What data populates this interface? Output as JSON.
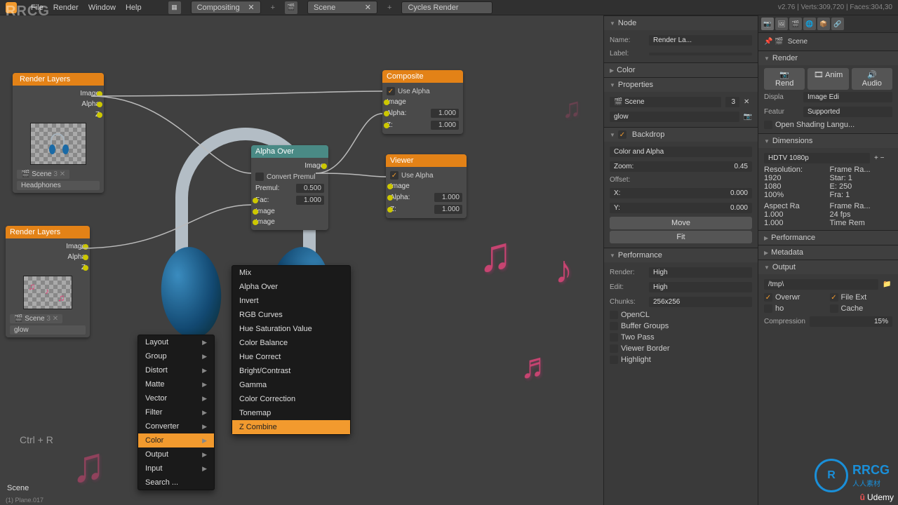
{
  "topbar": {
    "menus": [
      "File",
      "Render",
      "Window",
      "Help"
    ],
    "layout_label": "Compositing",
    "scene_label": "Scene",
    "engine_label": "Cycles Render",
    "stats": "v2.76 | Verts:309,720 | Faces:304,30"
  },
  "nodes": {
    "rl1": {
      "title": "Render Layers",
      "outs": [
        "Image",
        "Alpha",
        "Z"
      ],
      "scene_field": "Scene",
      "layer_field": "Headphones"
    },
    "rl2": {
      "title": "Render Layers",
      "outs": [
        "Image",
        "Alpha",
        "Z"
      ],
      "scene_field": "Scene",
      "layer_field": "glow"
    },
    "alpha_over": {
      "title": "Alpha Over",
      "out": "Image",
      "convert": "Convert Premul",
      "premul_v": "0.500",
      "fac": "Fac:",
      "fac_v": "1.000",
      "img": "Image",
      "img2": "Image"
    },
    "composite": {
      "title": "Composite",
      "use_alpha": "Use Alpha",
      "img": "Image",
      "alpha": "Alpha:",
      "alpha_v": "1.000",
      "z": "Z:",
      "z_v": "1.000"
    },
    "viewer": {
      "title": "Viewer",
      "use_alpha": "Use Alpha",
      "img": "Image",
      "alpha": "Alpha:",
      "alpha_v": "1.000",
      "z": "Z:",
      "z_v": "1.000"
    }
  },
  "ctx_menu_1": [
    "Layout",
    "Group",
    "Distort",
    "Matte",
    "Vector",
    "Filter",
    "Converter",
    "Color",
    "Output",
    "Input",
    "Search ..."
  ],
  "ctx_menu_2": [
    "Mix",
    "Alpha Over",
    "Invert",
    "RGB Curves",
    "Hue Saturation Value",
    "Color Balance",
    "Hue Correct",
    "Bright/Contrast",
    "Gamma",
    "Color Correction",
    "Tonemap",
    "Z Combine"
  ],
  "panel1": {
    "node_h": "Node",
    "name_l": "Name:",
    "name_v": "Render La...",
    "label_l": "Label:",
    "color_h": "Color",
    "props_h": "Properties",
    "scene_v": "Scene",
    "scene_count": "3",
    "layer_v": "glow",
    "backdrop_h": "Backdrop",
    "color_alpha": "Color and Alpha",
    "zoom_l": "Zoom:",
    "zoom_v": "0.45",
    "offset_l": "Offset:",
    "x_l": "X:",
    "x_v": "0.000",
    "y_l": "Y:",
    "y_v": "0.000",
    "move_btn": "Move",
    "fit_btn": "Fit",
    "perf_h": "Performance",
    "render_l": "Render:",
    "render_v": "High",
    "edit_l": "Edit:",
    "edit_v": "High",
    "chunks_l": "Chunks:",
    "chunks_v": "256x256",
    "opencl": "OpenCL",
    "buffer": "Buffer Groups",
    "twopass": "Two Pass",
    "viewer_b": "Viewer Border",
    "highlight": "Highlight"
  },
  "panel2": {
    "scene_h": "Scene",
    "render_h": "Render",
    "rend_btn": "Rend",
    "anim_btn": "Anim",
    "audio_btn": "Audio",
    "displa_l": "Displa",
    "displa_v": "Image Edi",
    "featur_l": "Featur",
    "featur_v": "Supported",
    "osl": "Open Shading Langu...",
    "dim_h": "Dimensions",
    "preset": "HDTV 1080p",
    "res_l": "Resolution:",
    "frame_ra_l": "Frame Ra...",
    "res_x": "1920",
    "star": "Star: 1",
    "res_y": "1080",
    "end": "E: 250",
    "res_pct": "100%",
    "fra": "Fra: 1",
    "aspect_l": "Aspect Ra",
    "frame_rate_l": "Frame Ra...",
    "asp_x": "1.000",
    "fps": "24 fps",
    "asp_y": "1.000",
    "time_rem": "Time Rem",
    "perf_h": "Performance",
    "meta_h": "Metadata",
    "output_h": "Output",
    "path": "/tmp\\",
    "overwr": "Overwr",
    "file_ext": "File Ext",
    "cache": "Cache",
    "compression": "Compression",
    "comp_v": "15%"
  },
  "watermark": "RRCG",
  "udemy": "Udemy",
  "rrcg": {
    "big": "RRCG",
    "sub": "人人素材"
  },
  "scene_corner": "Scene",
  "kbd_hint": "Ctrl + R"
}
